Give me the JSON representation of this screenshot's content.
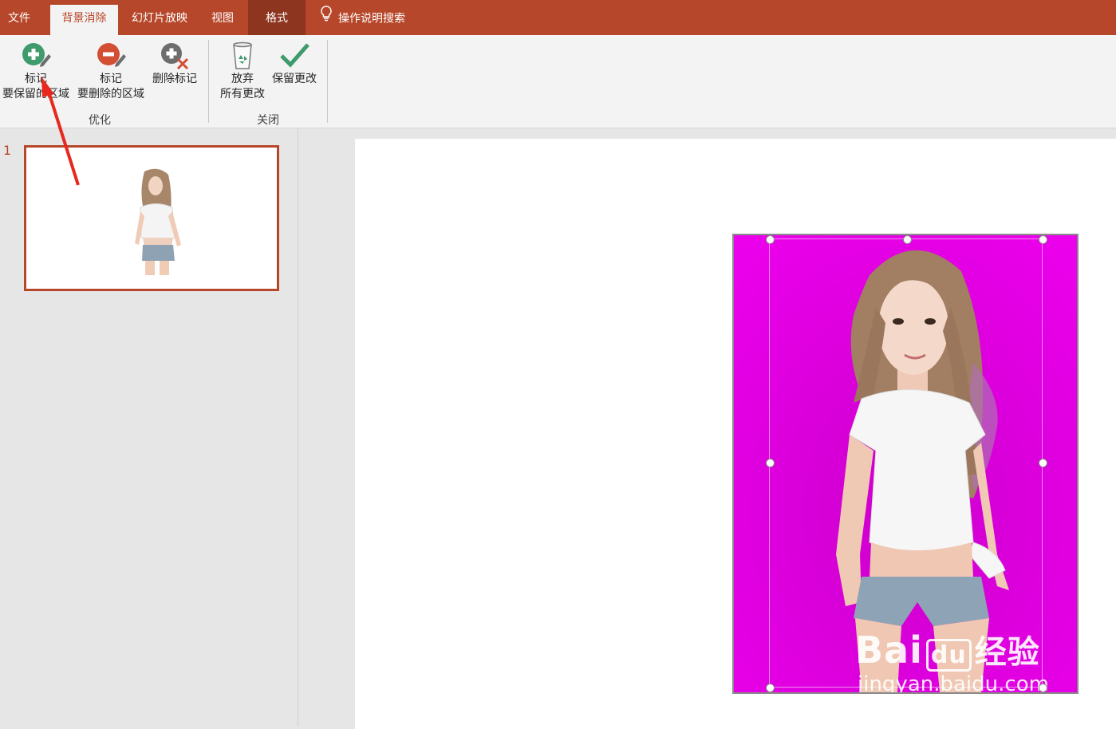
{
  "tabs": [
    {
      "label": "文件",
      "active": false
    },
    {
      "label": "背景消除",
      "active": true
    },
    {
      "label": "幻灯片放映",
      "active": false
    },
    {
      "label": "视图",
      "active": false
    },
    {
      "label": "格式",
      "active": false,
      "contextual": true
    }
  ],
  "search": {
    "label": "操作说明搜索",
    "icon": "lightbulb-icon"
  },
  "ribbon": {
    "refine_group": {
      "label": "优化",
      "mark_keep": {
        "line1": "标记",
        "line2": "要保留的区域",
        "icon": "plus-pencil-icon"
      },
      "mark_remove": {
        "line1": "标记",
        "line2": "要删除的区域",
        "icon": "minus-pencil-icon"
      },
      "delete_mark": {
        "line1": "删除标记",
        "icon": "delete-mark-icon"
      }
    },
    "close_group": {
      "label": "关闭",
      "discard": {
        "line1": "放弃",
        "line2": "所有更改",
        "icon": "recycle-bin-icon"
      },
      "keep": {
        "line1": "保留更改",
        "icon": "checkmark-icon"
      }
    }
  },
  "thumbnails": [
    {
      "number": "1"
    }
  ],
  "watermark": {
    "brand": "Bai",
    "brand_cn": "经验",
    "url": "jingyan.baidu.com"
  },
  "colors": {
    "accent": "#b7472a",
    "removal_overlay": "#ee00ee"
  }
}
